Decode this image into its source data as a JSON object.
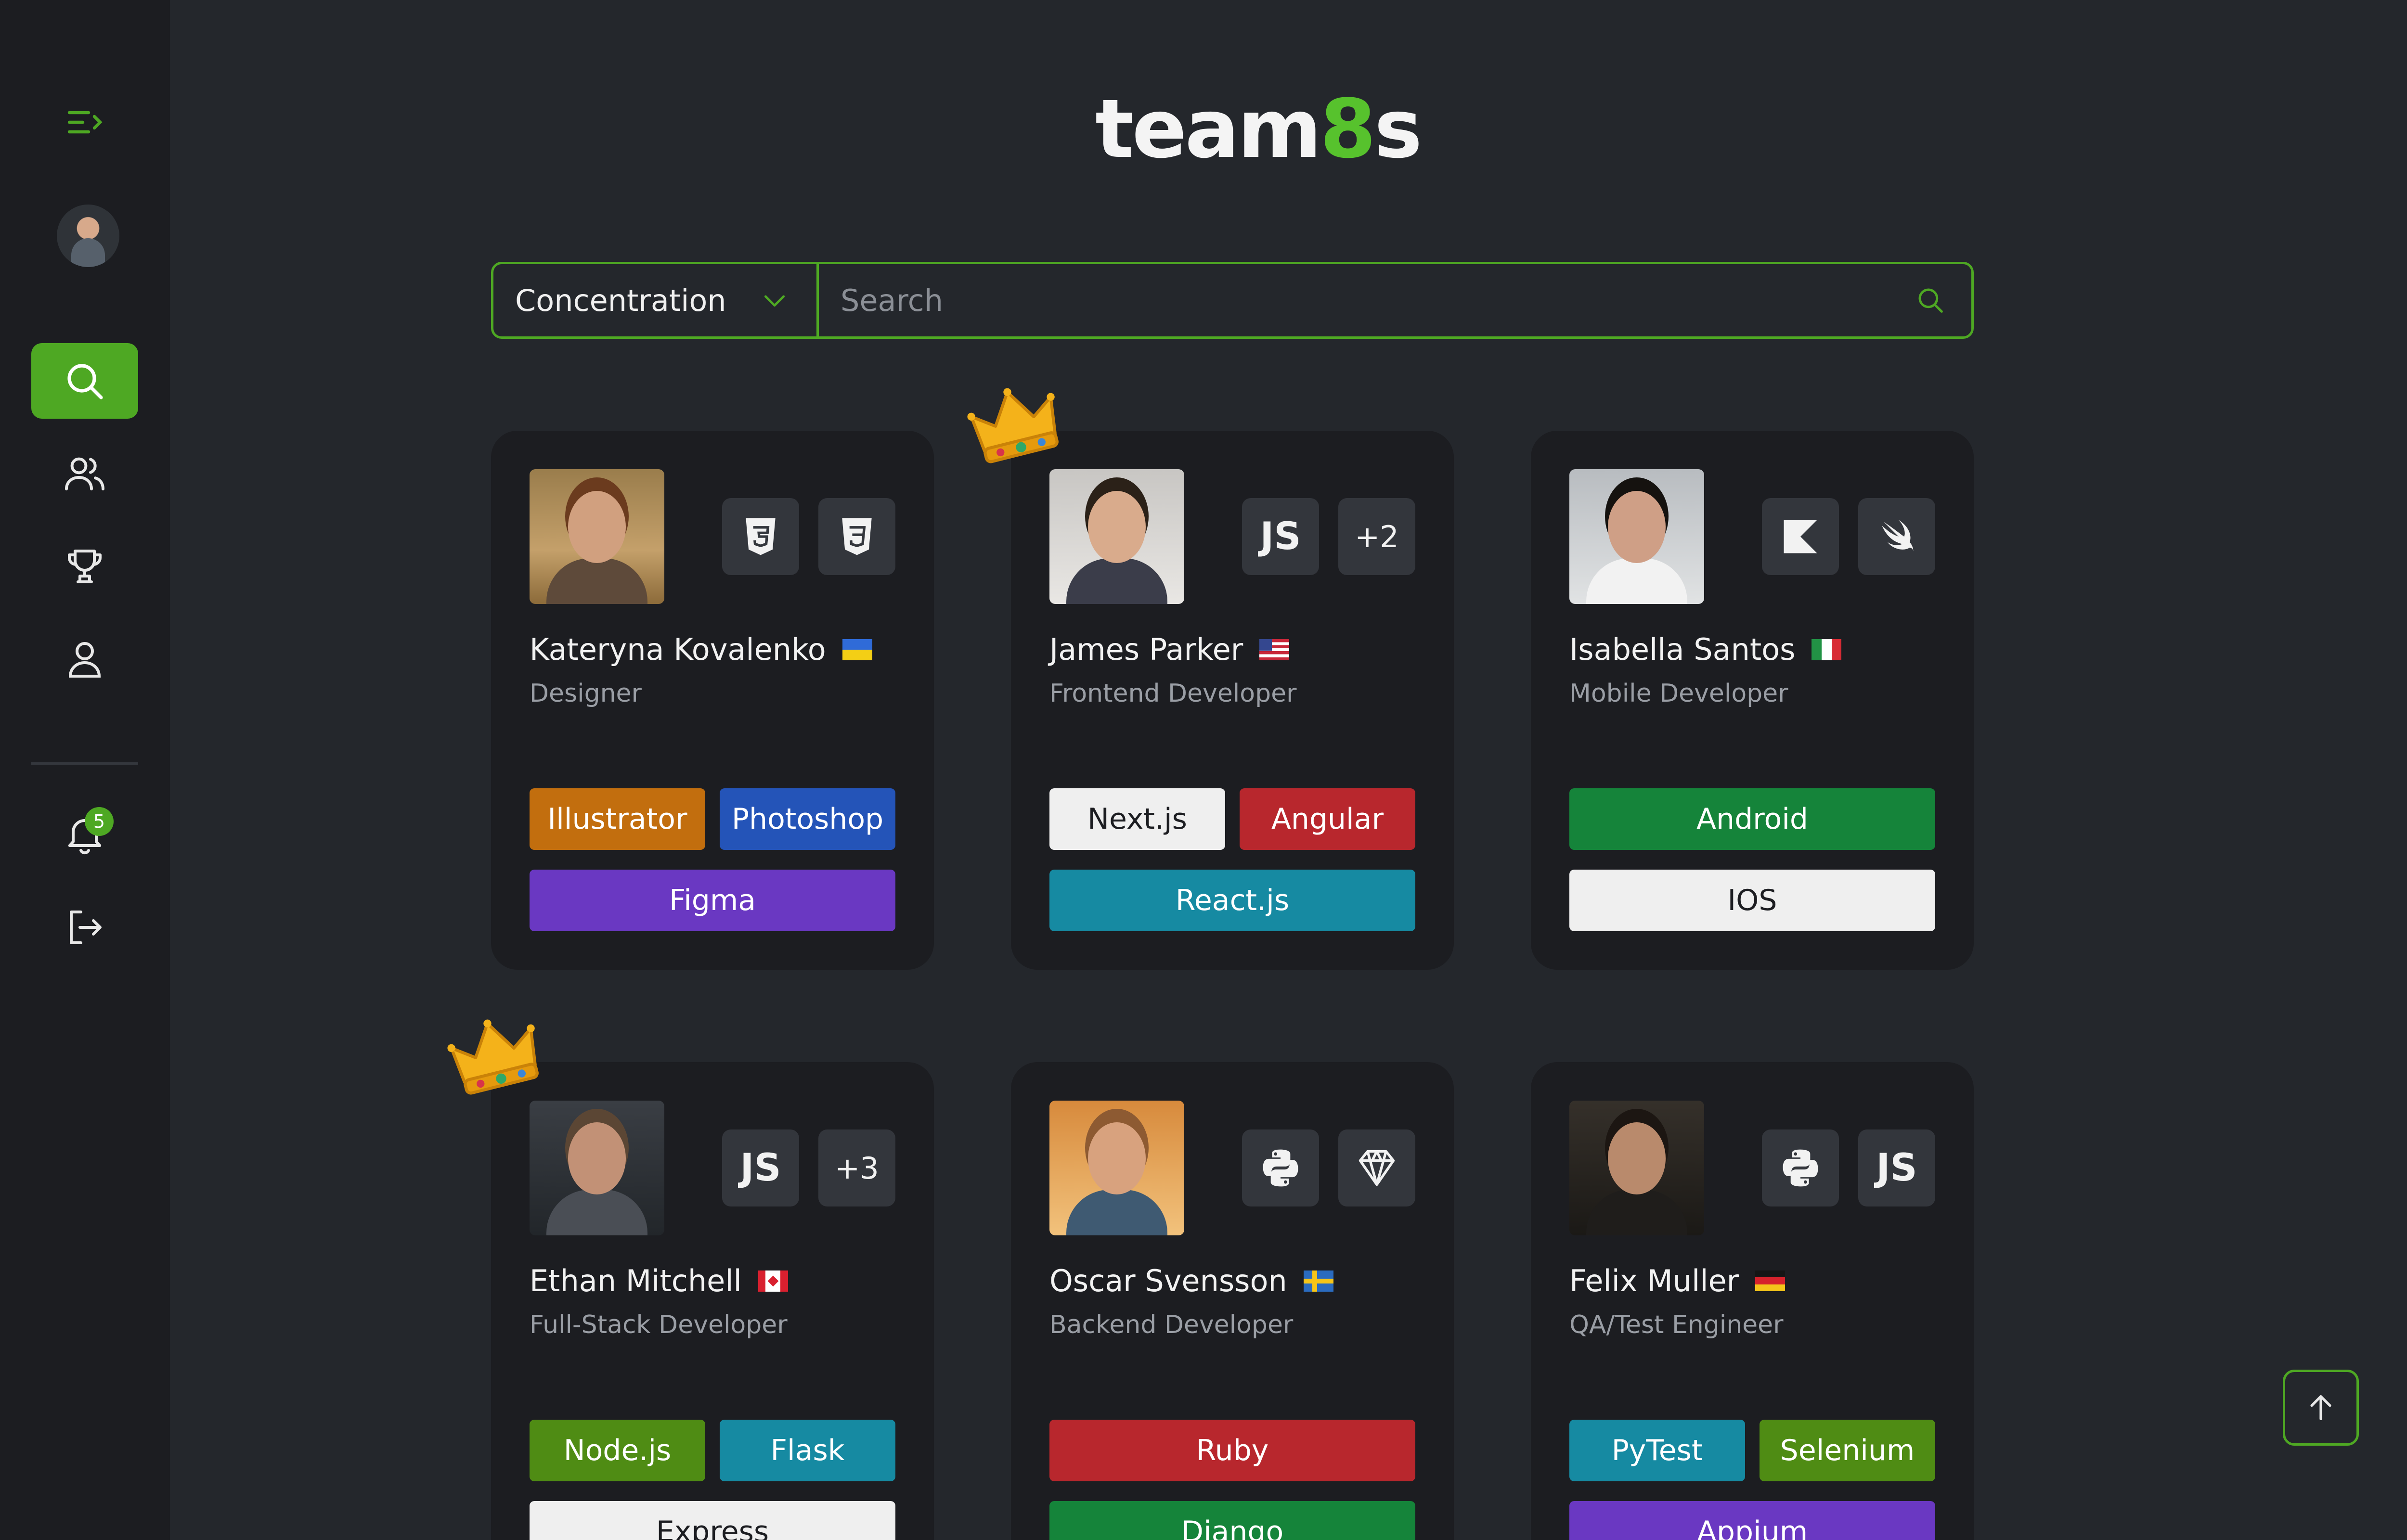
{
  "app": {
    "logo_prefix": "team",
    "logo_accent": "8",
    "logo_suffix": "s",
    "accent_color": "#4ea823"
  },
  "sidebar": {
    "notification_count": "5",
    "items": [
      {
        "icon": "menu-collapse-icon"
      },
      {
        "icon": "avatar"
      },
      {
        "icon": "search-icon",
        "active": true
      },
      {
        "icon": "users-icon"
      },
      {
        "icon": "trophy-icon"
      },
      {
        "icon": "user-icon"
      },
      {
        "icon": "bell-icon"
      },
      {
        "icon": "logout-icon"
      }
    ]
  },
  "search": {
    "filter_label": "Concentration",
    "placeholder": "Search"
  },
  "cards": [
    {
      "name": "Kateryna Kovalenko",
      "flag": "ua",
      "role": "Designer",
      "crown": false,
      "tech": [
        {
          "icon": "html5-icon"
        },
        {
          "icon": "css3-icon"
        }
      ],
      "tags": [
        "Illustrator",
        "Photoshop",
        "Figma"
      ],
      "tag_colors": [
        "#c26e0e",
        "#2454b8",
        "#6a38c2"
      ]
    },
    {
      "name": "James Parker",
      "flag": "us",
      "role": "Frontend Developer",
      "crown": true,
      "tech": [
        {
          "label": "JS"
        },
        {
          "label": "+2"
        }
      ],
      "tags": [
        "Next.js",
        "Angular",
        "React.js"
      ],
      "tag_colors": [
        "#efefef",
        "#b8272d",
        "#168aa2"
      ]
    },
    {
      "name": "Isabella Santos",
      "flag": "it",
      "role": "Mobile Developer",
      "crown": false,
      "tech": [
        {
          "icon": "kotlin-icon"
        },
        {
          "icon": "swift-icon"
        }
      ],
      "tags": [
        "Android",
        "IOS"
      ],
      "tag_colors": [
        "#15843a",
        "#efefef"
      ]
    },
    {
      "name": "Ethan Mitchell",
      "flag": "ca",
      "role": "Full-Stack Developer",
      "crown": true,
      "tech": [
        {
          "label": "JS"
        },
        {
          "label": "+3"
        }
      ],
      "tags": [
        "Node.js",
        "Flask",
        "Express"
      ],
      "tag_colors": [
        "#4f8c14",
        "#168aa2",
        "#efefef"
      ]
    },
    {
      "name": "Oscar Svensson",
      "flag": "se",
      "role": "Backend Developer",
      "crown": false,
      "tech": [
        {
          "icon": "python-icon"
        },
        {
          "icon": "ruby-icon"
        }
      ],
      "tags": [
        "Ruby",
        "Django"
      ],
      "tag_colors": [
        "#b8272d",
        "#15843a"
      ]
    },
    {
      "name": "Felix Muller",
      "flag": "de",
      "role": "QA/Test Engineer",
      "crown": false,
      "tech": [
        {
          "icon": "python-icon"
        },
        {
          "label": "JS"
        }
      ],
      "tags": [
        "PyTest",
        "Selenium",
        "Appium"
      ],
      "tag_colors": [
        "#168aa2",
        "#4f8c14",
        "#6a38c2"
      ]
    }
  ]
}
